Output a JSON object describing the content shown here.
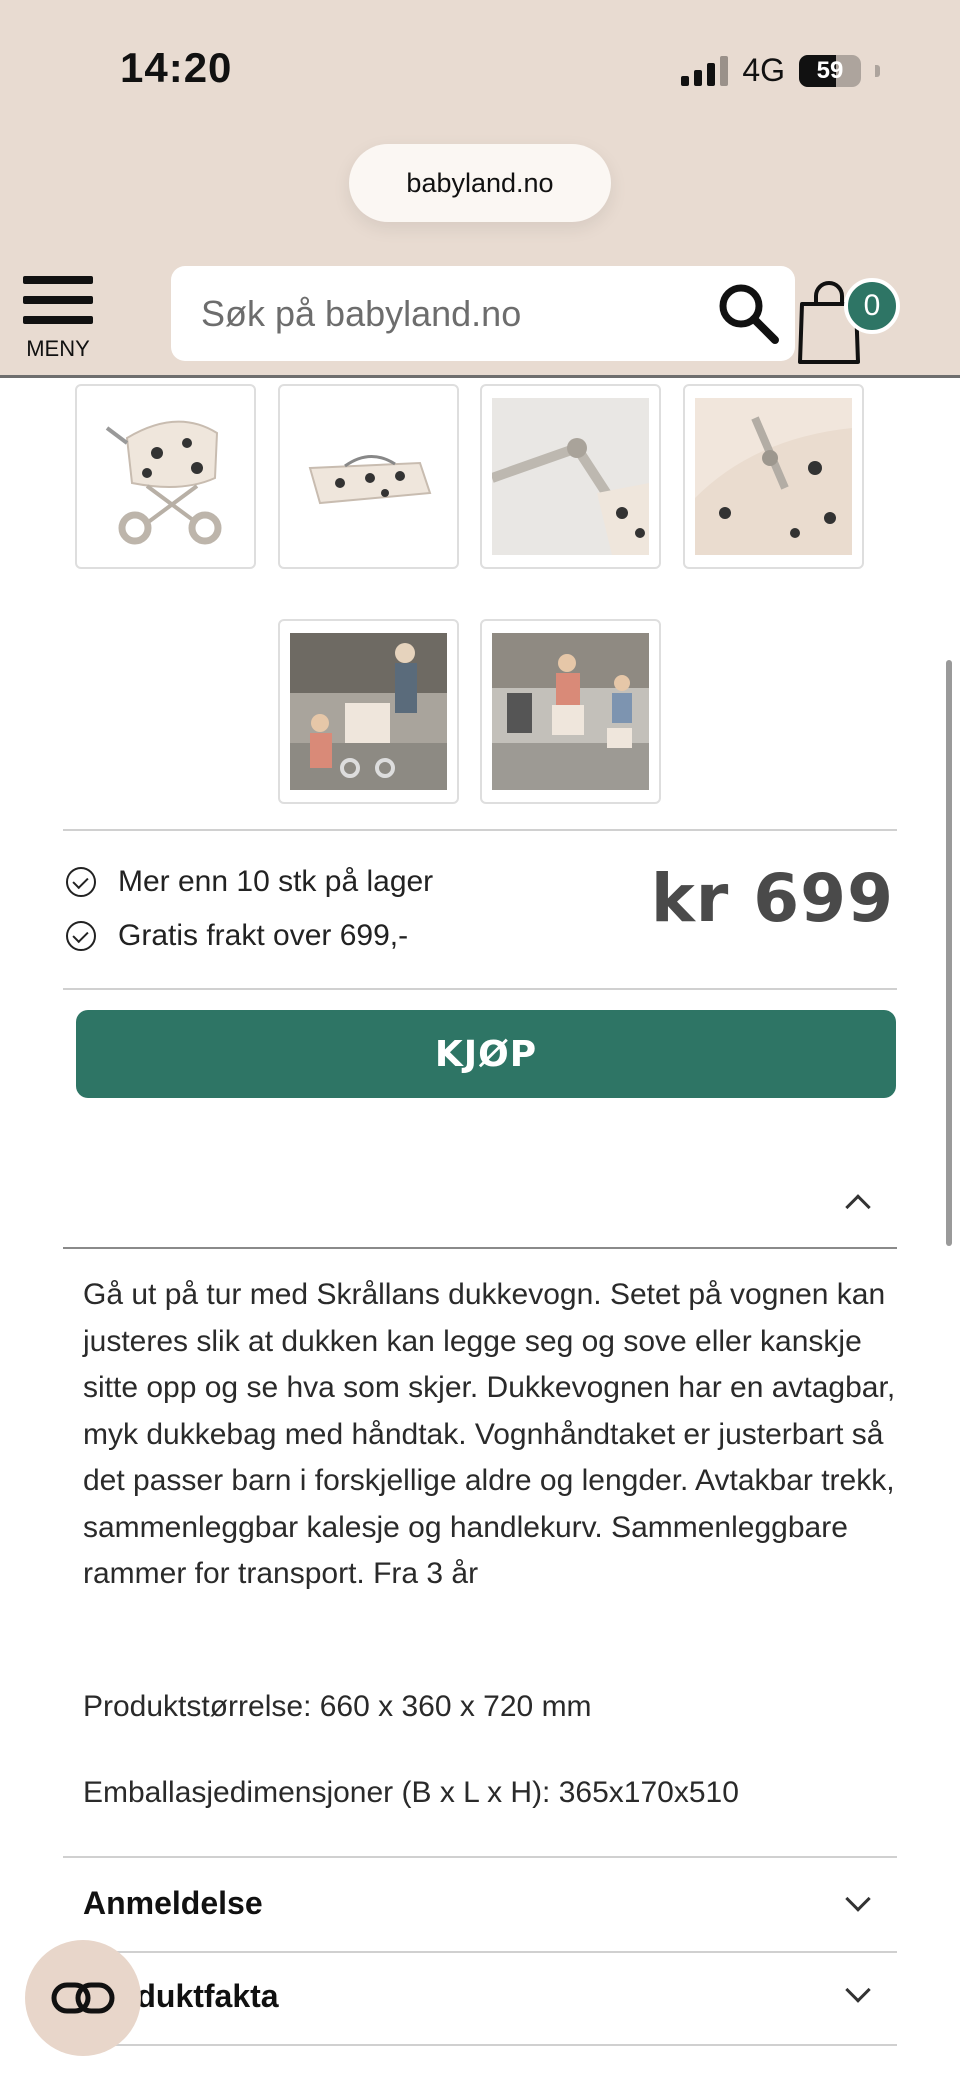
{
  "status_bar": {
    "time": "14:20",
    "network": "4G",
    "battery_level": "59",
    "battery_fraction": 0.59
  },
  "browser": {
    "url": "babyland.no"
  },
  "header": {
    "menu_label": "MENY",
    "search_placeholder": "Søk på babyland.no",
    "cart_count": "0",
    "brand_color": "#2e7565",
    "header_bg": "#e8dbd1"
  },
  "gallery": {
    "thumbnails": [
      "doll-pram-icon",
      "carrycot-icon",
      "frame-hinge-icon",
      "hood-detail-icon",
      "lifestyle-photo-1-icon",
      "lifestyle-photo-2-icon"
    ]
  },
  "stock": {
    "availability": "Mer enn 10 stk på lager",
    "shipping": "Gratis frakt over 699,-"
  },
  "price": "kr 699",
  "buy_label": "KJØP",
  "description": {
    "text": "Gå ut på tur med Skrållans dukkevogn. Setet på vognen kan justeres slik at dukken kan legge seg og sove eller kanskje sitte opp og se hva som skjer. Dukkevognen har en avtagbar, myk dukkebag med håndtak. Vognhåndtaket er justerbart så det passer barn i forskjellige aldre og lengder. Avtakbar trekk, sammenleggbar kalesje og handlekurv. Sammenleggbare rammer for transport. Fra 3 år",
    "product_size": "Produktstørrelse: 660 x 360 x 720 mm",
    "package_size": "Emballasjedimensjoner (B x L x H): 365x170x510"
  },
  "accordions": {
    "reviews": "Anmeldelse",
    "product_facts": "Produktfakta"
  }
}
